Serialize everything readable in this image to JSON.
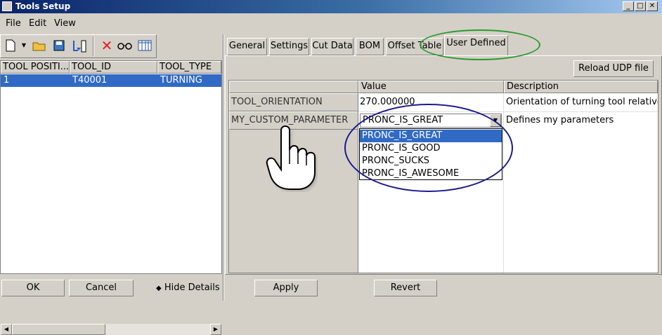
{
  "window": {
    "title": "Tools Setup",
    "min": "_",
    "max": "□",
    "close": "✕"
  },
  "menu": {
    "file": "File",
    "edit": "Edit",
    "view": "View"
  },
  "toolbar": {
    "icons": [
      "new-file-icon",
      "dropdown-arrow-icon",
      "open-folder-icon",
      "save-icon",
      "import-tools-icon",
      "delete-icon",
      "glasses-icon",
      "columns-icon"
    ]
  },
  "tool_list": {
    "columns": [
      "TOOL POSITI...",
      "TOOL_ID",
      "TOOL_TYPE"
    ],
    "rows": [
      {
        "position": "1",
        "tool_id": "T40001",
        "tool_type": "TURNING"
      }
    ]
  },
  "bottom_left": {
    "ok": "OK",
    "cancel": "Cancel",
    "hide_details": "Hide Details",
    "hide_icon": "◆"
  },
  "tabs": [
    "General",
    "Settings",
    "Cut Data",
    "BOM",
    "Offset Table",
    "User Defined"
  ],
  "user_defined": {
    "reload": "Reload UDP file",
    "columns": {
      "value": "Value",
      "description": "Description"
    },
    "rows": [
      {
        "name": "TOOL_ORIENTATION",
        "value": "270.000000",
        "description": "Orientation of turning tool relative to r"
      },
      {
        "name": "MY_CUSTOM_PARAMETER",
        "value": "PRONC_IS_GREAT",
        "description": "Defines my parameters"
      }
    ],
    "options": [
      "PRONC_IS_GREAT",
      "PRONC_IS_GOOD",
      "PRONC_SUCKS",
      "PRONC_IS_AWESOME"
    ]
  },
  "bottom_right": {
    "apply": "Apply",
    "revert": "Revert"
  },
  "colors": {
    "selection": "#316ac5",
    "annotation_green": "#2e9a2e",
    "annotation_blue": "#1a1a8c"
  }
}
